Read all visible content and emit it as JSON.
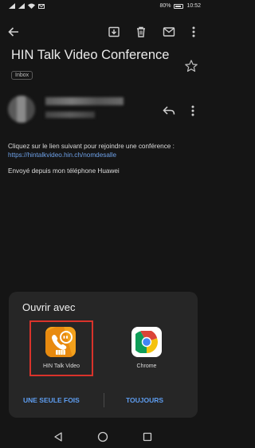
{
  "status": {
    "battery": "80%",
    "time": "10:52"
  },
  "email": {
    "subject": "HIN Talk Video Conference",
    "label": "Inbox",
    "body_text": "Cliquez sur le lien suivant pour rejoindre une conférence : ",
    "link": "https://hintalkvideo.hin.ch/nomdesalle",
    "signature": "Envoyé depuis mon téléphone Huawei"
  },
  "open_with": {
    "title": "Ouvrir avec",
    "apps": [
      {
        "label": "HIN Talk Video",
        "icon": "hin-talk-video-icon"
      },
      {
        "label": "Chrome",
        "icon": "chrome-icon"
      }
    ],
    "once_label": "UNE SEULE FOIS",
    "always_label": "TOUJOURS"
  },
  "colors": {
    "accent": "#5e9df0",
    "highlight": "#d9332b",
    "hin_orange": "#f3a11c"
  }
}
